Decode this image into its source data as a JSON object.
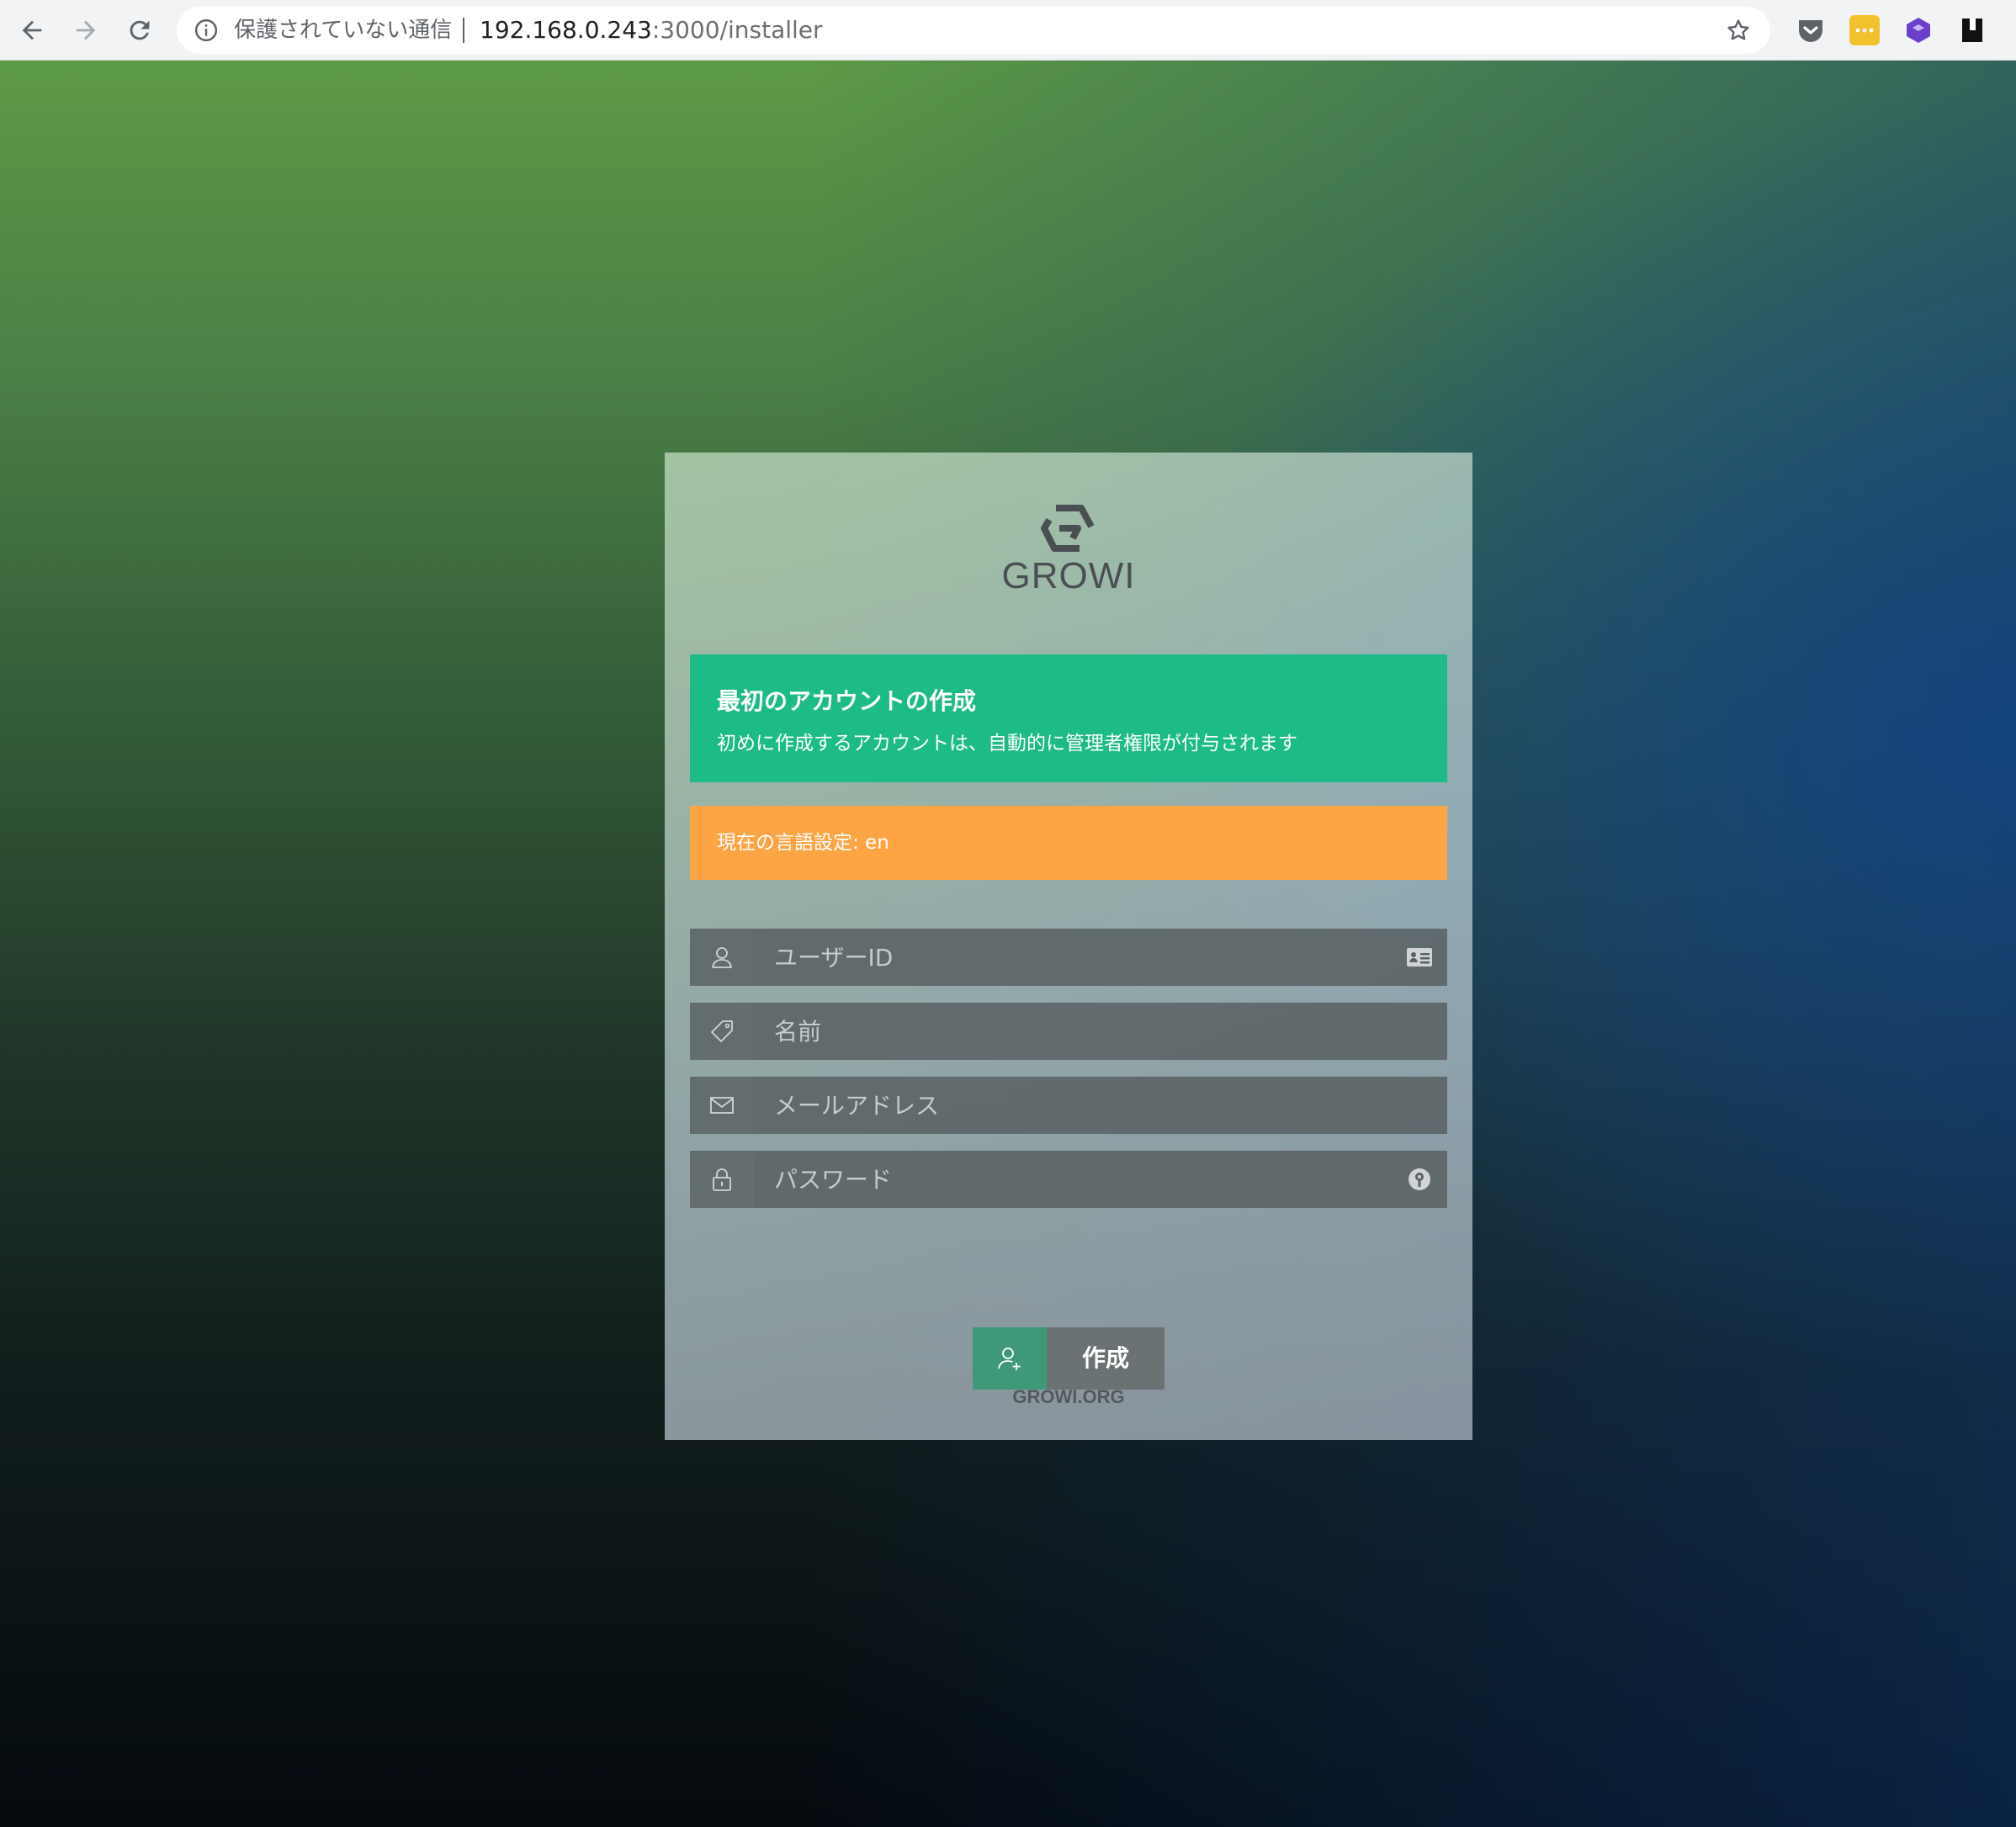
{
  "browser": {
    "security_label": "保護されていない通信",
    "url_host": "192.168.0.243",
    "url_path": ":3000/installer",
    "extension_colors": [
      "#5f6368",
      "#f2c12e",
      "#6b3fc9",
      "#111111"
    ]
  },
  "card": {
    "brand": "GROWI",
    "success_alert": {
      "title": "最初のアカウントの作成",
      "body": "初めに作成するアカウントは、自動的に管理者権限が付与されます",
      "color": "#1dbb88"
    },
    "warning_alert": {
      "text": "現在の言語設定: en",
      "color": "#fda444"
    },
    "fields": {
      "username_placeholder": "ユーザーID",
      "name_placeholder": "名前",
      "email_placeholder": "メールアドレス",
      "password_placeholder": "パスワード"
    },
    "create_button": "作成",
    "footer_link": "GROWI.ORG"
  }
}
